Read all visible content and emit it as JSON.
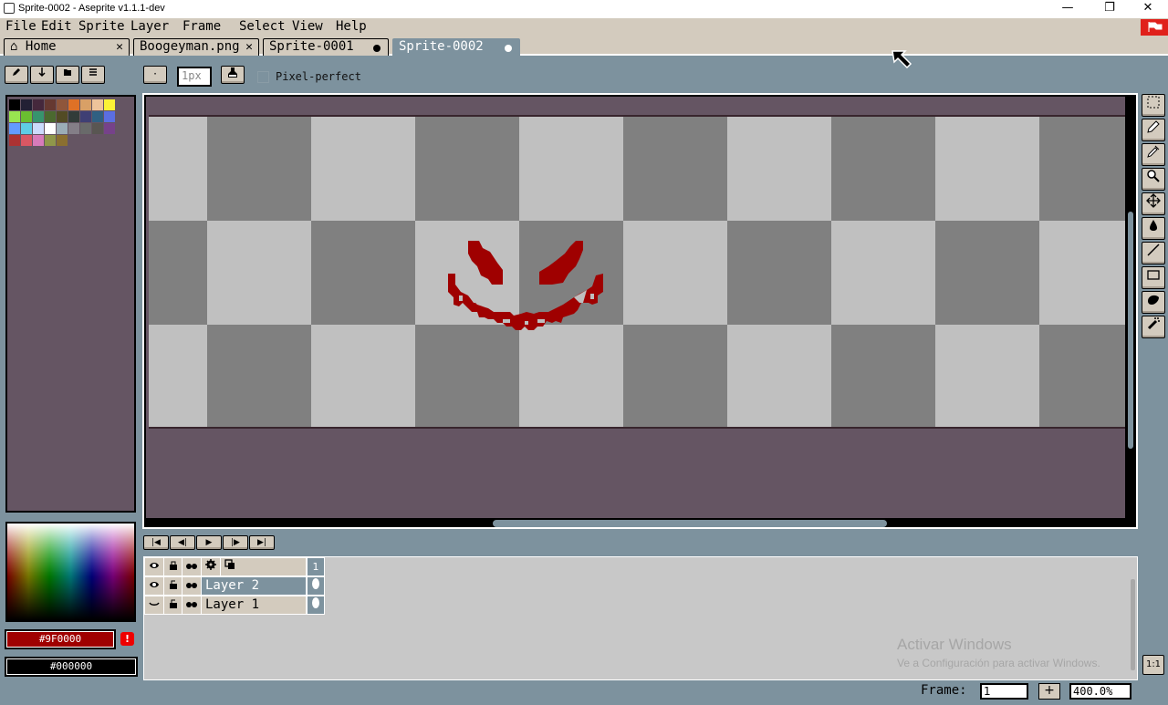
{
  "window": {
    "title": "Sprite-0002 - Aseprite v1.1.1-dev",
    "minimize": "—",
    "restore": "❐",
    "close": "✕"
  },
  "menu": [
    "File",
    "Edit",
    "Sprite",
    "Layer",
    "Frame",
    "Select",
    "View",
    "Help"
  ],
  "tabs": [
    {
      "label": "Home",
      "icon": "home-icon",
      "close": "✕"
    },
    {
      "label": "Boogeyman.png",
      "close": "✕"
    },
    {
      "label": "Sprite-0001",
      "modified": true
    },
    {
      "label": "Sprite-0002",
      "modified": true,
      "active": true
    }
  ],
  "toolbar": {
    "brush_type": "·",
    "brush_size": "1px",
    "ink_icon": "ink-bucket-icon",
    "pixel_perfect": "Pixel-perfect",
    "palette_buttons": [
      "edit-palette-icon",
      "sort-palette-icon",
      "preset-icon",
      "palette-options-icon"
    ]
  },
  "palette": [
    "#000000",
    "#222034",
    "#45283c",
    "#663931",
    "#8f563b",
    "#df7126",
    "#d9a066",
    "#eec39a",
    "#fbf236",
    "#99e550",
    "#6abe30",
    "#37946e",
    "#4b692f",
    "#524b24",
    "#323c39",
    "#3f3f74",
    "#306082",
    "#5b6ee1",
    "#639bff",
    "#5fcde4",
    "#cbdbfc",
    "#ffffff",
    "#9badb7",
    "#847e87",
    "#696a6a",
    "#595652",
    "#76428a",
    "#ac3232",
    "#d95763",
    "#d77bba",
    "#8f974a",
    "#8a6f30"
  ],
  "colors": {
    "foreground": "#9F0000",
    "background": "#000000",
    "warning": "!"
  },
  "tools": [
    "marquee-icon",
    "pencil-icon",
    "eyedropper-icon",
    "zoom-icon",
    "move-icon",
    "bucket-icon",
    "line-icon",
    "rectangle-icon",
    "ellipse-icon",
    "spray-icon"
  ],
  "playback": [
    "first-frame-icon",
    "prev-frame-icon",
    "play-icon",
    "next-frame-icon",
    "last-frame-icon"
  ],
  "playback_glyphs": [
    "|◀",
    "◀|",
    "▶",
    "|▶",
    "▶|"
  ],
  "timeline": {
    "header_icons": [
      "eye-icon",
      "lock-icon",
      "continuous-icon",
      "gear-icon",
      "onion-skin-icon"
    ],
    "frame_number": "1",
    "layers": [
      {
        "name": "Layer 2",
        "selected": true
      },
      {
        "name": "Layer 1",
        "selected": false
      }
    ]
  },
  "watermark": {
    "line1": "Activar Windows",
    "line2": "Ve a Configuración para activar Windows."
  },
  "status": {
    "frame_label": "Frame:",
    "frame_value": "1",
    "plus": "+",
    "zoom": "400.0%",
    "ratio": "1:1"
  }
}
